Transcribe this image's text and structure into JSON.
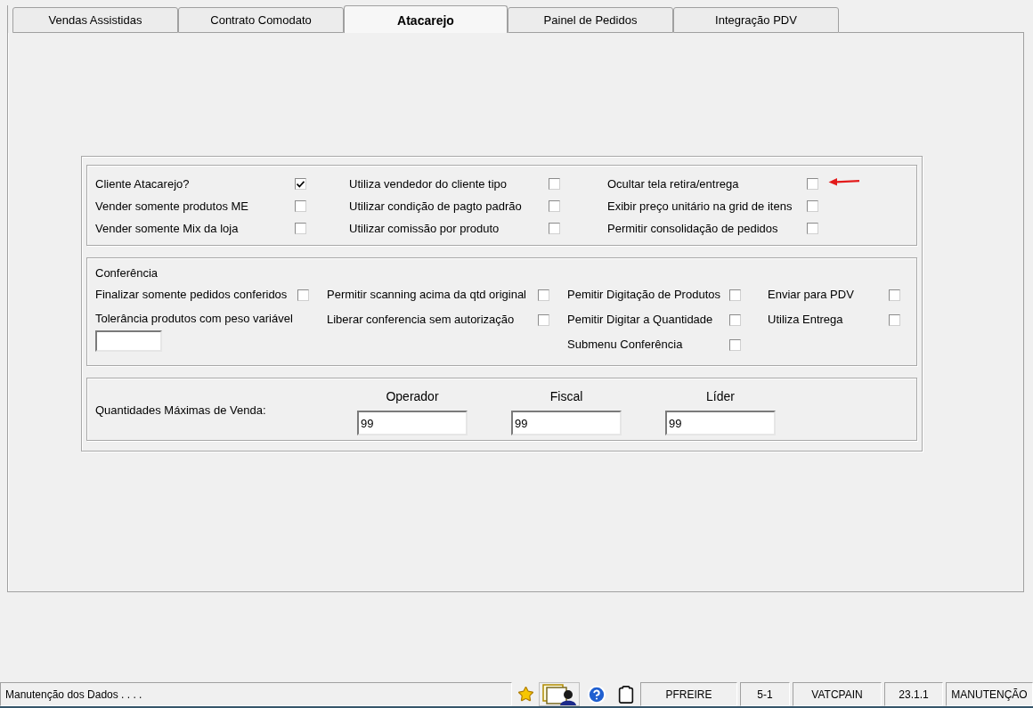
{
  "tabs": [
    {
      "label": "Vendas Assistidas",
      "selected": false
    },
    {
      "label": "Contrato Comodato",
      "selected": false
    },
    {
      "label": "Atacarejo",
      "selected": true
    },
    {
      "label": "Painel de Pedidos",
      "selected": false
    },
    {
      "label": "Integração PDV",
      "selected": false
    }
  ],
  "general_options": [
    {
      "label": "Cliente Atacarejo?",
      "checked": true
    },
    {
      "label": "Utiliza vendedor do cliente tipo",
      "checked": false
    },
    {
      "label": "Ocultar tela retira/entrega",
      "checked": false
    },
    {
      "label": "Vender somente produtos ME",
      "checked": false
    },
    {
      "label": "Utilizar condição de pagto padrão",
      "checked": false
    },
    {
      "label": "Exibir preço unitário na grid de itens",
      "checked": false
    },
    {
      "label": "Vender somente Mix da loja",
      "checked": false
    },
    {
      "label": "Utilizar comissão por produto",
      "checked": false
    },
    {
      "label": "Permitir consolidação de pedidos",
      "checked": false
    }
  ],
  "conferencia": {
    "title": "Conferência",
    "columns": [
      {
        "items": [
          {
            "kind": "checkbox",
            "label": "Finalizar somente pedidos conferidos",
            "checked": false
          },
          {
            "kind": "input",
            "label": "Tolerância produtos com peso variável"
          }
        ]
      },
      {
        "items": [
          {
            "kind": "checkbox",
            "label": "Permitir scanning acima da qtd original",
            "checked": false
          },
          {
            "kind": "checkbox",
            "label": "Liberar conferencia sem autorização",
            "checked": false
          }
        ]
      },
      {
        "items": [
          {
            "kind": "checkbox",
            "label": "Pemitir Digitação de Produtos",
            "checked": false
          },
          {
            "kind": "checkbox",
            "label": "Pemitir Digitar a Quantidade",
            "checked": false
          },
          {
            "kind": "checkbox",
            "label": "Submenu Conferência",
            "checked": false
          }
        ]
      },
      {
        "items": [
          {
            "kind": "checkbox",
            "label": "Enviar para PDV",
            "checked": false
          },
          {
            "kind": "checkbox",
            "label": "Utiliza Entrega",
            "checked": false
          }
        ]
      }
    ]
  },
  "quantidades": {
    "label": "Quantidades Máximas de Venda:",
    "fields": [
      {
        "label": "Operador",
        "value": "99"
      },
      {
        "label": "Fiscal",
        "value": "99"
      },
      {
        "label": "Líder",
        "value": "99"
      }
    ]
  },
  "status_bar": {
    "message": "Manutenção dos Dados . . . .",
    "cells": [
      "PFREIRE",
      "5-1",
      "VATCPAIN",
      "23.1.1",
      "MANUTENÇÃO"
    ]
  }
}
